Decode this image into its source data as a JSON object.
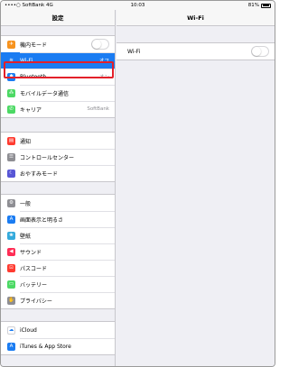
{
  "status_bar": {
    "carrier": "••••○ SoftBank  4G",
    "time": "10:03",
    "battery": "81%"
  },
  "sidebar": {
    "title": "設定",
    "groups": [
      [
        {
          "label": "機内モード",
          "icon": "airplane-icon",
          "color": "#f7931e",
          "glyph": "✈",
          "toggle": true
        },
        {
          "label": "Wi-Fi",
          "icon": "wifi-icon",
          "color": "#1a7cf2",
          "glyph": "≋",
          "value": "オフ",
          "selected": true
        },
        {
          "label": "Bluetooth",
          "icon": "bluetooth-icon",
          "color": "#1a7cf2",
          "glyph": "✱",
          "value": "オン"
        },
        {
          "label": "モバイルデータ通信",
          "icon": "cellular-icon",
          "color": "#4cd964",
          "glyph": "⁂"
        },
        {
          "label": "キャリア",
          "icon": "phone-icon",
          "color": "#4cd964",
          "glyph": "✆",
          "value": "SoftBank"
        }
      ],
      [
        {
          "label": "通知",
          "icon": "notifications-icon",
          "color": "#ff3b30",
          "glyph": "▤"
        },
        {
          "label": "コントロールセンター",
          "icon": "control-center-icon",
          "color": "#8e8e93",
          "glyph": "☰"
        },
        {
          "label": "おやすみモード",
          "icon": "moon-icon",
          "color": "#5856d6",
          "glyph": "☾"
        }
      ],
      [
        {
          "label": "一般",
          "icon": "gear-icon",
          "color": "#8e8e93",
          "glyph": "⚙"
        },
        {
          "label": "画面表示と明るさ",
          "icon": "display-icon",
          "color": "#1a7cf2",
          "glyph": "A"
        },
        {
          "label": "壁紙",
          "icon": "wallpaper-icon",
          "color": "#34aadc",
          "glyph": "❀"
        },
        {
          "label": "サウンド",
          "icon": "sound-icon",
          "color": "#ff2d55",
          "glyph": "◀"
        },
        {
          "label": "パスコード",
          "icon": "passcode-icon",
          "color": "#ff3b30",
          "glyph": "⊡"
        },
        {
          "label": "バッテリー",
          "icon": "battery-icon",
          "color": "#4cd964",
          "glyph": "▭"
        },
        {
          "label": "プライバシー",
          "icon": "privacy-icon",
          "color": "#8e8e93",
          "glyph": "✋"
        }
      ],
      [
        {
          "label": "iCloud",
          "icon": "icloud-icon",
          "color": "#ffffff",
          "glyph": "☁",
          "glyph_color": "#1a7cf2"
        },
        {
          "label": "iTunes & App Store",
          "icon": "app-store-icon",
          "color": "#1a7cf2",
          "glyph": "A"
        }
      ]
    ]
  },
  "detail": {
    "title": "Wi-Fi",
    "wifi_row_label": "Wi-Fi",
    "wifi_on": false
  }
}
